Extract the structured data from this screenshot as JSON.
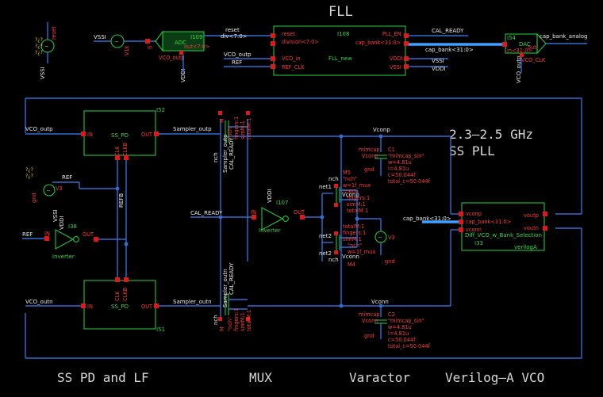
{
  "titles": {
    "fll": "FLL",
    "pll": [
      "2.3–2.5 GHz",
      "SS PLL"
    ],
    "sections": [
      "SS PD and LF",
      "MUX",
      "Varactor",
      "Verilog–A VCO"
    ]
  },
  "fll_row": {
    "reset_src": {
      "label": "reset",
      "net": "VSSI",
      "yellow": "?¿?"
    },
    "vdc": {
      "label": "VSSI",
      "param": "V1k"
    },
    "adc": {
      "inst": "I109",
      "name": "ADC",
      "in": "in",
      "out": "out<7:0>",
      "vin": "VCO_outp",
      "vdd": "VDDI"
    },
    "fll": {
      "inst": "I108",
      "name": "FLL_new",
      "left_nets": [
        "reset",
        "div<7:0>",
        "VCO_outp",
        "REF"
      ],
      "left_pins": [
        "reset",
        "division<7:0>",
        "VCO_in",
        "REF_CLK"
      ],
      "right_pins": [
        "PLL_EN",
        "cap_bank<31:0>",
        "VDDI",
        "VSSI"
      ],
      "right_nets": [
        "CAL_READY",
        "cap_bank<31:0>",
        "VSSI",
        "VDDI"
      ]
    },
    "dac": {
      "inst": "I54",
      "name": "DAC",
      "in": "in<31:0>",
      "out": "out",
      "vin": "VCO_outp",
      "vout": "VCO_CLK",
      "out_net": "cap_bank_analog"
    }
  },
  "pd_top": {
    "inst": "I52",
    "name": "SS_PD",
    "in": "IN",
    "out": "OUT",
    "clk": "CLK",
    "clkb": "CLKB",
    "in_net": "VCO_outp",
    "out_net": "Sampler_outp"
  },
  "pd_bot": {
    "inst": "I51",
    "name": "SS_PD",
    "in": "IN",
    "out": "OUT",
    "clk": "CLK",
    "clkb": "CLKB",
    "in_net": "VCO_outn",
    "out_net": "Sampler_outn"
  },
  "ref": {
    "src_label": "REF",
    "src_param": "V3",
    "net": "REF",
    "refb": "REFB",
    "yellow": "?¿?",
    "gnd": "gnd"
  },
  "inv_left": {
    "inst": "I38",
    "name": "Inverter",
    "in": "IN",
    "out": "OUT",
    "vdd": "VDDI",
    "vss": "VSSI"
  },
  "inv_mid": {
    "inst": "I107",
    "name": "Inverter",
    "in": "IN",
    "out": "OUT",
    "vdd": "VDDI",
    "net": "CAL_READY"
  },
  "mux_top": {
    "name": "M",
    "params": [
      "nch",
      "\"nch\"",
      "fingers:1",
      "simM:1",
      "totalM:1"
    ],
    "sampler": "Sampler_outp",
    "cal": "CAL_READY"
  },
  "mux_bot": {
    "name": "M",
    "params": [
      "nch",
      "\"nch\"",
      "fingers:1",
      "simM:1",
      "totalM:1"
    ],
    "sampler": "Sampler_outn",
    "cal": "CAL_READY"
  },
  "varactor": {
    "top_cap": {
      "inst": "C1",
      "type": "mimcap",
      "params": [
        "\"mimcap_sin\"",
        "w=4.81u",
        "l=4.81u",
        "c=50.044f",
        "total_c=50.044f"
      ],
      "net": "Vconp"
    },
    "bot_cap": {
      "inst": "C2",
      "type": "mimcap",
      "params": [
        "\"mimcap_sin\"",
        "w=4.81u",
        "l=4.81u",
        "c=50.044f",
        "total_c=50.044f"
      ],
      "net": "Vconn"
    },
    "m_top": {
      "inst": "M5",
      "params": [
        "nch",
        "\"nch\"",
        "w=1f_mux",
        "l=60n",
        "fingers:1",
        "simM:1",
        "totalM:1"
      ]
    },
    "m_bot": {
      "inst": "M4",
      "params": [
        "nch",
        "\"nch\"",
        "w=1f_mux",
        "fingers:1",
        "simM:1",
        "totalM:1"
      ]
    },
    "vsrc": {
      "inst": "V3",
      "label": "gnd"
    },
    "nets": [
      "Vconp",
      "Vconn",
      "net1",
      "net1",
      "net2",
      "net2"
    ]
  },
  "vco": {
    "name": "Diff_VCO_w_Bank_Selection",
    "inst": "I33",
    "type": "verilogA",
    "pins": [
      "vconp",
      "cap_bank<31:0>",
      "vconn"
    ],
    "outs": [
      "voutp",
      "voutn"
    ],
    "bank_net": "cap_bank<31:0>"
  },
  "nets": {
    "vco_outp": "VCO_outp",
    "vco_outn": "VCO_outn",
    "cal": "CAL_READY",
    "vconp": "Vconp",
    "vconn": "Vconn"
  }
}
